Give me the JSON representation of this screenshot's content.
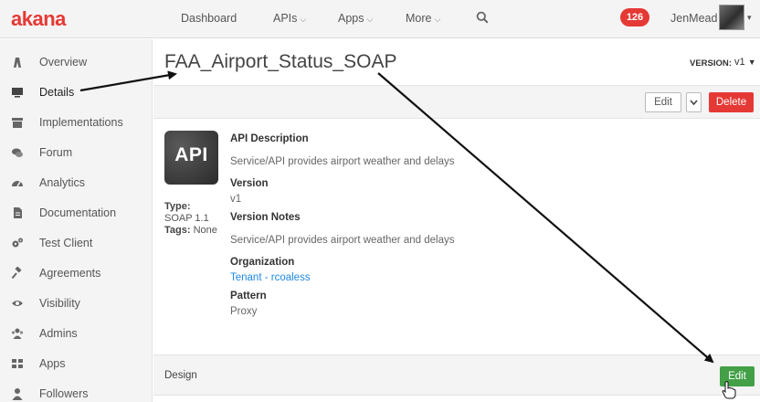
{
  "header": {
    "logo": "akana",
    "nav": [
      {
        "label": "Dashboard",
        "has_dropdown": false
      },
      {
        "label": "APIs",
        "has_dropdown": true
      },
      {
        "label": "Apps",
        "has_dropdown": true
      },
      {
        "label": "More",
        "has_dropdown": true
      }
    ],
    "notification_count": "126",
    "username": "JenMead",
    "badge_color": "#e53935"
  },
  "sidebar": {
    "items": [
      {
        "label": "Overview",
        "icon": "sitemap-icon"
      },
      {
        "label": "Details",
        "icon": "monitor-icon",
        "active": true
      },
      {
        "label": "Implementations",
        "icon": "archive-icon"
      },
      {
        "label": "Forum",
        "icon": "comments-icon"
      },
      {
        "label": "Analytics",
        "icon": "dashboard-icon"
      },
      {
        "label": "Documentation",
        "icon": "document-icon"
      },
      {
        "label": "Test Client",
        "icon": "gears-icon"
      },
      {
        "label": "Agreements",
        "icon": "gavel-icon"
      },
      {
        "label": "Visibility",
        "icon": "eye-icon"
      },
      {
        "label": "Admins",
        "icon": "users-icon"
      },
      {
        "label": "Apps",
        "icon": "grid-icon"
      },
      {
        "label": "Followers",
        "icon": "user-icon"
      }
    ]
  },
  "main": {
    "title": "FAA_Airport_Status_SOAP",
    "version_label": "VERSION:",
    "version_value": "v1",
    "toolbar": {
      "edit": "Edit",
      "delete": "Delete",
      "delete_color": "#e53935"
    },
    "api_icon_text": "API",
    "meta": {
      "type_label": "Type:",
      "type_value": "SOAP 1.1",
      "tags_label": "Tags:",
      "tags_value": "None"
    },
    "fields": {
      "description_label": "API Description",
      "description_value": "Service/API provides airport weather and delays",
      "version_label": "Version",
      "version_value": "v1",
      "notes_label": "Version Notes",
      "notes_value": "Service/API provides airport weather and delays",
      "org_label": "Organization",
      "org_value": "Tenant - rcoaless",
      "pattern_label": "Pattern",
      "pattern_value": "Proxy"
    },
    "design": {
      "label": "Design",
      "edit": "Edit",
      "edit_color": "#43a047"
    }
  }
}
